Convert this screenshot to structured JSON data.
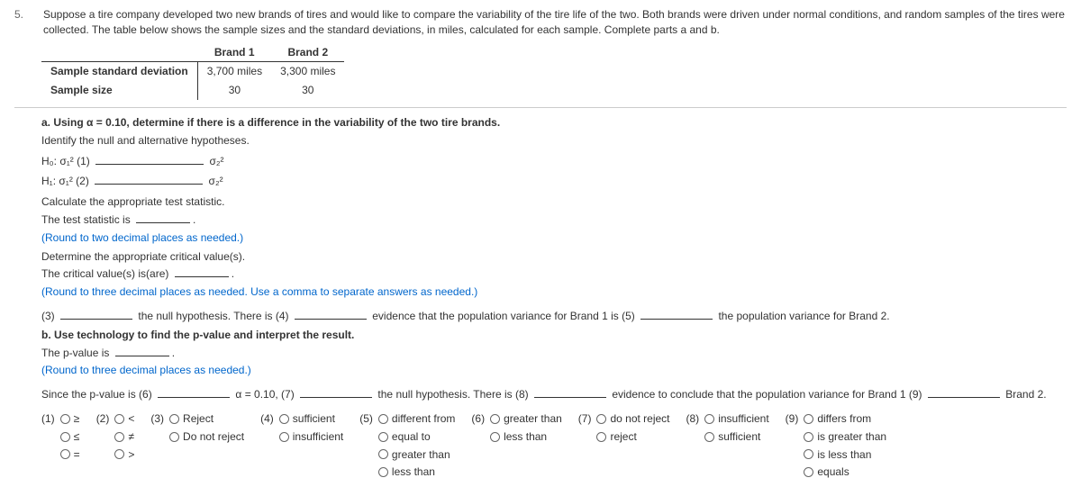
{
  "question_number": "5.",
  "problem_text": "Suppose a tire company developed two new brands of tires and would like to compare the variability of the tire life of the two. Both brands were driven under normal conditions, and random samples of the tires were collected. The table below shows the sample sizes and the standard deviations, in miles, calculated for each sample. Complete parts a and b.",
  "table": {
    "col1": "Brand 1",
    "col2": "Brand 2",
    "row1_label": "Sample standard deviation",
    "row1_v1": "3,700 miles",
    "row1_v2": "3,300 miles",
    "row2_label": "Sample size",
    "row2_v1": "30",
    "row2_v2": "30"
  },
  "part_a_intro": "a. Using α = 0.10, determine if there is a difference in the variability of the two tire brands.",
  "identify_hyp": "Identify the null and alternative hypotheses.",
  "h0_label": "H₀: σ₁² (1)",
  "h0_rhs": "σ₂²",
  "h1_label": "H₁: σ₁² (2)",
  "h1_rhs": "σ₂²",
  "calc_stat": "Calculate the appropriate test statistic.",
  "test_stat_line": "The test statistic is",
  "round2": "(Round to two decimal places as needed.)",
  "det_crit": "Determine the appropriate critical value(s).",
  "crit_line": "The critical value(s) is(are)",
  "round3_crit": "(Round to three decimal places as needed. Use a comma to separate answers as needed.)",
  "sentence_a": {
    "s1": "(3)",
    "s2": "the null hypothesis. There is (4)",
    "s3": "evidence that the population variance for Brand 1 is (5)",
    "s4": "the population variance for Brand 2."
  },
  "part_b_intro": "b. Use technology to find the p-value and interpret the result.",
  "pvalue_line": "The p-value is",
  "round3_p": "(Round to three decimal places as needed.)",
  "sentence_b": {
    "s1": "Since the p-value is (6)",
    "s2": "α = 0.10, (7)",
    "s3": "the null hypothesis. There is (8)",
    "s4": "evidence to conclude that the population variance for Brand 1 (9)",
    "s5": "Brand 2."
  },
  "answers": {
    "g1": {
      "num": "(1)",
      "opts": [
        "≥",
        "≤",
        "="
      ]
    },
    "g2": {
      "num": "(2)",
      "opts": [
        "<",
        "≠",
        ">"
      ]
    },
    "g3": {
      "num": "(3)",
      "opts": [
        "Reject",
        "Do not reject"
      ]
    },
    "g4": {
      "num": "(4)",
      "opts": [
        "sufficient",
        "insufficient"
      ]
    },
    "g5": {
      "num": "(5)",
      "opts": [
        "different from",
        "equal to",
        "greater than",
        "less than"
      ]
    },
    "g6": {
      "num": "(6)",
      "opts": [
        "greater than",
        "less than"
      ]
    },
    "g7": {
      "num": "(7)",
      "opts": [
        "do not reject",
        "reject"
      ]
    },
    "g8": {
      "num": "(8)",
      "opts": [
        "insufficient",
        "sufficient"
      ]
    },
    "g9": {
      "num": "(9)",
      "opts": [
        "differs from",
        "is greater than",
        "is less than",
        "equals"
      ]
    }
  }
}
